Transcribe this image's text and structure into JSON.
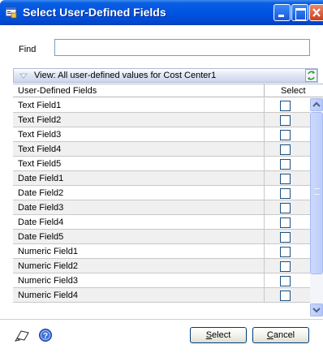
{
  "window": {
    "title": "Select User-Defined Fields",
    "controls": [
      "minimize-icon",
      "maximize-icon",
      "close-icon"
    ]
  },
  "find": {
    "label": "Find",
    "value": ""
  },
  "view": {
    "label": "View: All user-defined values for Cost Center1"
  },
  "grid": {
    "col_fields": "User-Defined Fields",
    "col_select": "Select",
    "rows": [
      {
        "label": "Text Field1",
        "checked": false
      },
      {
        "label": "Text Field2",
        "checked": false
      },
      {
        "label": "Text Field3",
        "checked": false
      },
      {
        "label": "Text Field4",
        "checked": false
      },
      {
        "label": "Text Field5",
        "checked": false
      },
      {
        "label": "Date Field1",
        "checked": false
      },
      {
        "label": "Date Field2",
        "checked": false
      },
      {
        "label": "Date Field3",
        "checked": false
      },
      {
        "label": "Date Field4",
        "checked": false
      },
      {
        "label": "Date Field5",
        "checked": false
      },
      {
        "label": "Numeric Field1",
        "checked": false
      },
      {
        "label": "Numeric Field2",
        "checked": false
      },
      {
        "label": "Numeric Field3",
        "checked": false
      },
      {
        "label": "Numeric Field4",
        "checked": false
      }
    ]
  },
  "buttons": {
    "select_first": "S",
    "select_rest": "elect",
    "cancel_first": "C",
    "cancel_rest": "ancel"
  },
  "colors": {
    "titlebar": "#0054e3",
    "view_bar": "#ccd5ec",
    "checkbox_border": "#1c5180"
  }
}
